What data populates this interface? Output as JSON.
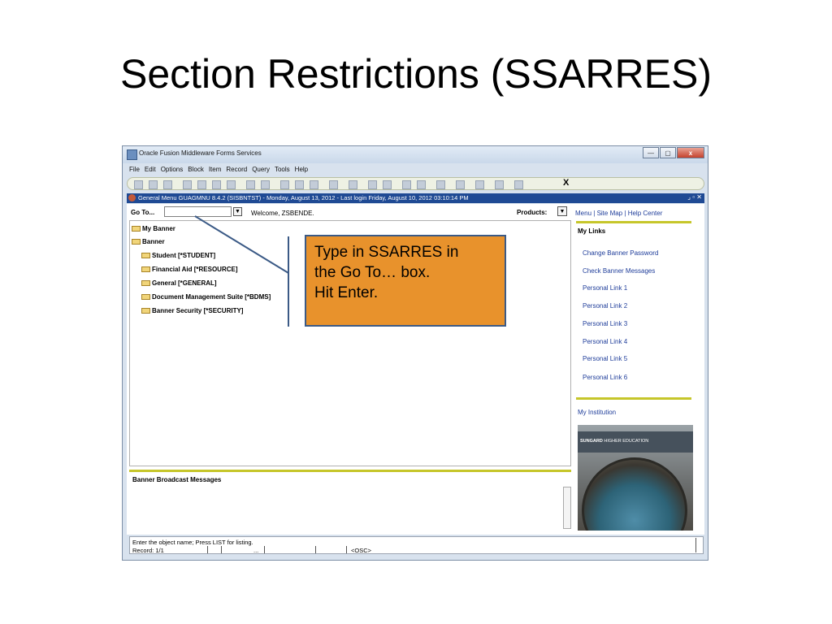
{
  "slide": {
    "title": "Section Restrictions (SSARRES)"
  },
  "window": {
    "title": "Oracle Fusion Middleware Forms Services",
    "buttons": {
      "minimize": "—",
      "maximize": "▢",
      "close": "x"
    }
  },
  "menu": {
    "items": [
      "File",
      "Edit",
      "Options",
      "Block",
      "Item",
      "Record",
      "Query",
      "Tools",
      "Help"
    ]
  },
  "toolbar": {
    "exit_label": "X"
  },
  "form_bar": {
    "text": "General Menu  GUAGMNU  8.4.2  (SISBNTST) - Monday, August 13, 2012 - Last login Friday, August 10, 2012 03:10:14 PM",
    "controls": "⌟ ▫ ✕"
  },
  "goto": {
    "label": "Go To...",
    "value": "",
    "dropdown_icon": "▼"
  },
  "welcome": "Welcome, ZSBENDE.",
  "products": {
    "label": "Products:",
    "dropdown_icon": "▼"
  },
  "tree": {
    "my_banner": "My Banner",
    "banner": "Banner",
    "children": [
      "Student [*STUDENT]",
      "Financial Aid [*RESOURCE]",
      "General [*GENERAL]",
      "Document Management Suite [*BDMS]",
      "Banner Security [*SECURITY]"
    ]
  },
  "broadcast": {
    "title": "Banner Broadcast Messages"
  },
  "right_panel": {
    "nav": {
      "menu": "Menu",
      "site_map": "Site Map",
      "help_center": "Help Center",
      "sep": "|"
    },
    "my_links_heading": "My Links",
    "links": [
      "Change Banner Password",
      "Check Banner Messages",
      "Personal Link 1",
      "Personal Link 2",
      "Personal Link 3",
      "Personal Link 4",
      "Personal Link 5",
      "Personal Link 6"
    ],
    "my_institution": "My Institution",
    "sungard_brand": "SUNGARD",
    "sungard_tagline": "HIGHER EDUCATION"
  },
  "status": {
    "message": "Enter the object name; Press LIST for listing.",
    "record": "Record: 1/1",
    "ellipsis": "...",
    "osc": "<OSC>"
  },
  "callout": {
    "lines": [
      "Type in SSARRES in",
      "the Go To… box.",
      "Hit Enter."
    ],
    "colors": {
      "fill": "#e8922c",
      "border": "#3b5a86",
      "pointer": "#3b5a86"
    }
  }
}
